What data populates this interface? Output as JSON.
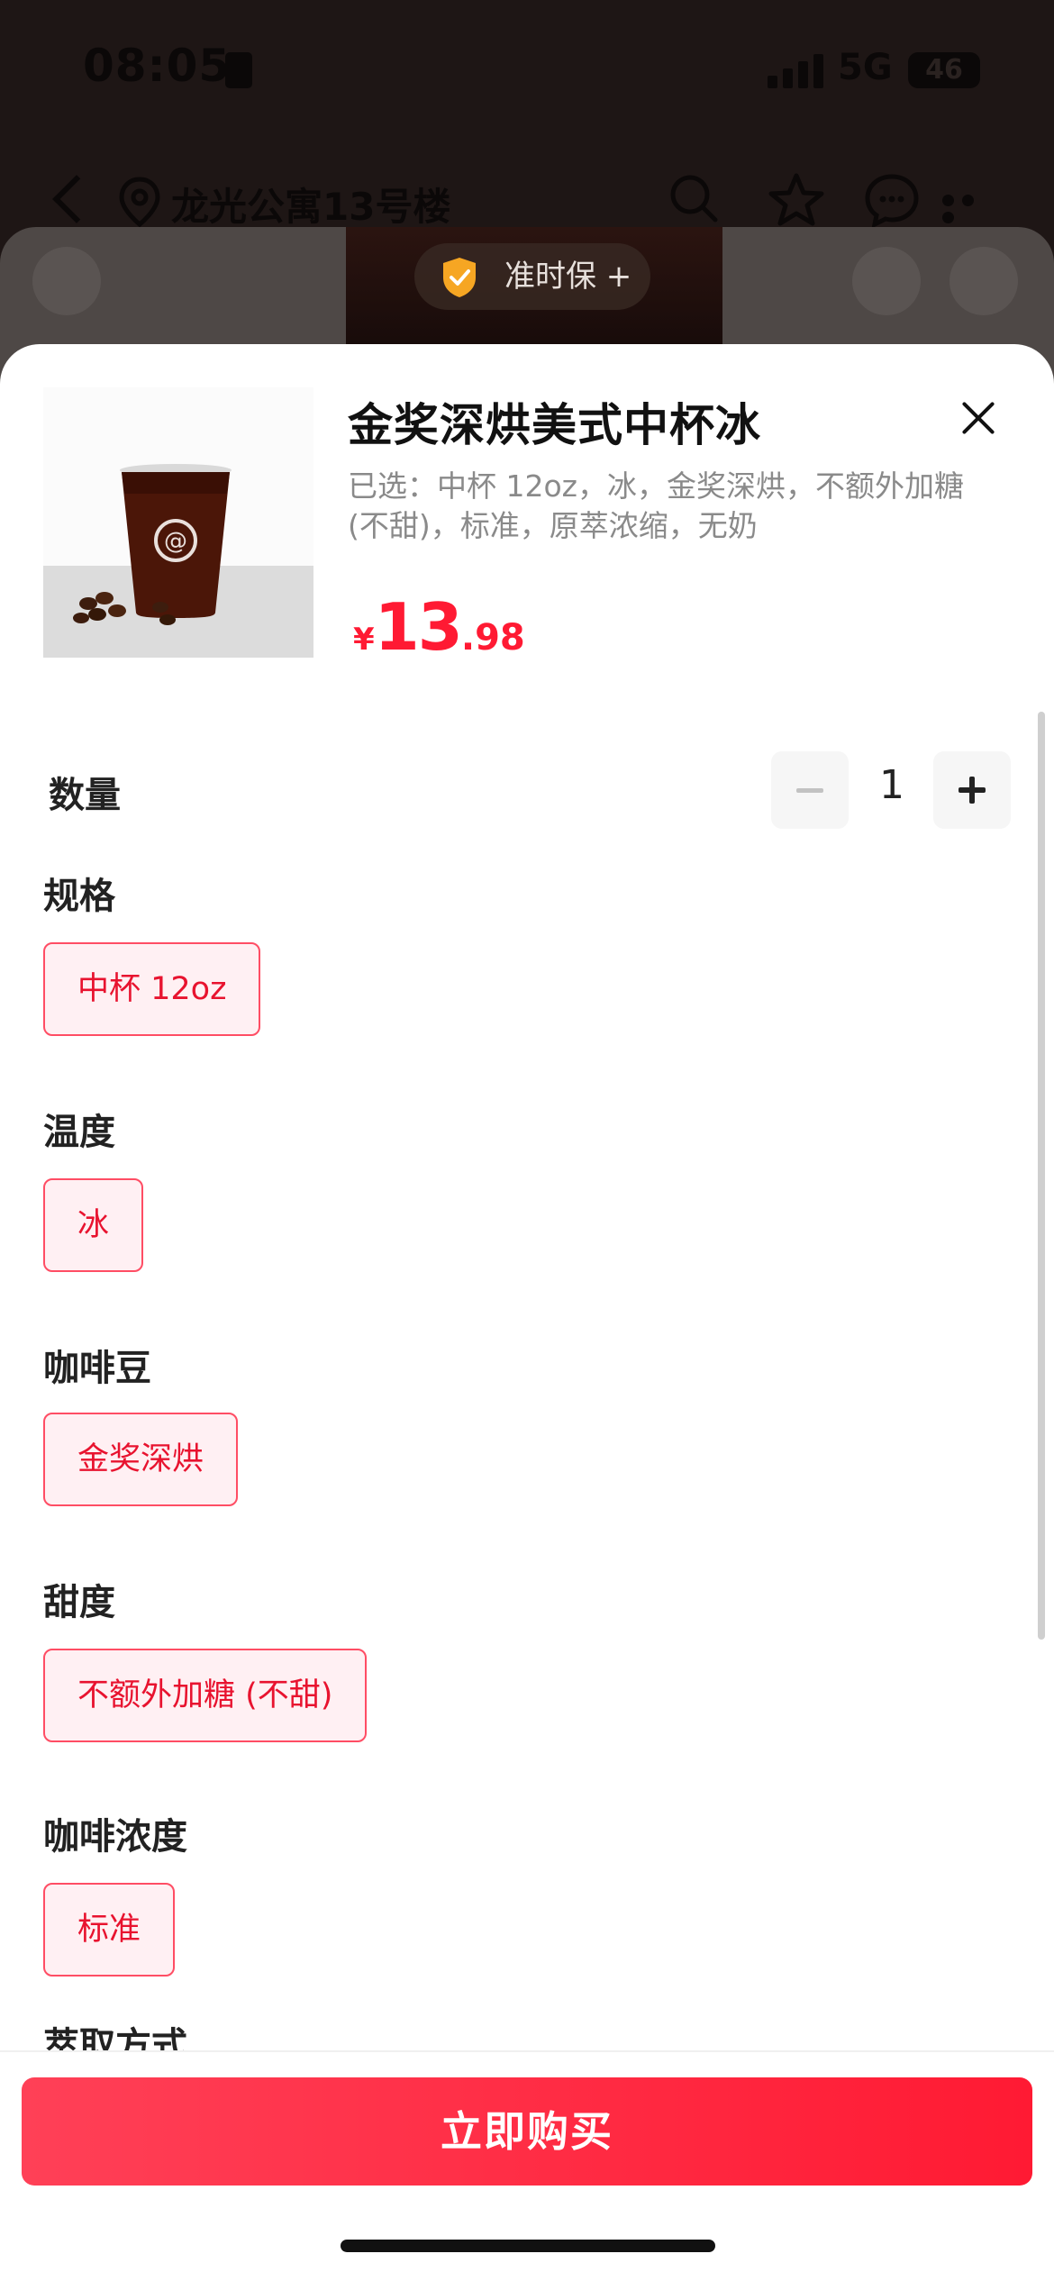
{
  "status_bar": {
    "time": "08:05",
    "network": "5G",
    "battery": "46"
  },
  "nav": {
    "location": "龙光公寓13号楼"
  },
  "badge": {
    "ontime": "准时保 +"
  },
  "product": {
    "title": "金奖深烘美式中杯冰",
    "selected": "已选：中杯 12oz，冰，金奖深烘，不额外加糖 (不甜)，标准，原萃浓缩，无奶",
    "price_symbol": "¥",
    "price_integer": "13",
    "price_decimal": ".98",
    "cup_logo": "@"
  },
  "quantity": {
    "label": "数量",
    "value": "1"
  },
  "options": [
    {
      "label": "规格",
      "choice": "中杯 12oz"
    },
    {
      "label": "温度",
      "choice": "冰"
    },
    {
      "label": "咖啡豆",
      "choice": "金奖深烘"
    },
    {
      "label": "甜度",
      "choice": "不额外加糖 (不甜)"
    },
    {
      "label": "咖啡浓度",
      "choice": "标准"
    },
    {
      "label": "萃取方式"
    }
  ],
  "buy_button": "立即购买",
  "colors": {
    "accent": "#ff1a33",
    "chip_bg": "#fff0f3",
    "chip_border": "#ff4d64"
  },
  "icons": [
    "back-arrow-icon",
    "location-pin-icon",
    "search-icon",
    "star-icon",
    "chat-icon",
    "more-icon",
    "shield-check-icon",
    "close-icon",
    "minus-icon",
    "plus-icon"
  ]
}
